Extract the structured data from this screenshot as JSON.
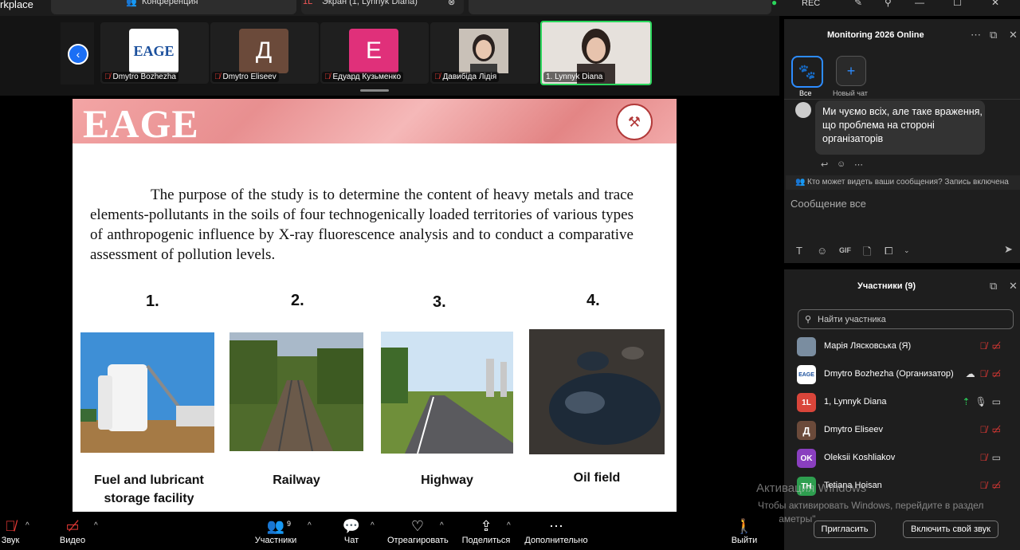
{
  "window": {
    "app_title": "rkplace"
  },
  "tabs": [
    {
      "label": "Конференция"
    },
    {
      "label": "Экран (1, Lynnyk Diana)"
    }
  ],
  "top_right": {
    "rec_label": "REC"
  },
  "thumbnails": [
    {
      "name": "Dmytro Bozhezha",
      "avatar_text": "EAGE",
      "color": "#ffffff"
    },
    {
      "name": "Dmytro Eliseev",
      "avatar_text": "Д",
      "color": "#6b4a3a"
    },
    {
      "name": "Едуард Кузьменко",
      "avatar_text": "Е",
      "color": "#e0307a"
    },
    {
      "name": "Давибіда Лідія",
      "avatar_text": "",
      "color": "#d8d0c8"
    },
    {
      "name": "1. Lynnyk Diana",
      "avatar_text": "",
      "color": "#e8e2dc"
    }
  ],
  "slide": {
    "logo": "EAGE",
    "purpose": "The purpose of the study is to determine the content of heavy metals and trace elements-pollutants in the soils of four technogenically loaded territories of various types of anthropogenic influence by X-ray fluorescence analysis and to conduct a comparative assessment of pollution levels.",
    "items": [
      {
        "num": "1.",
        "caption": "Fuel and lubricant storage facility"
      },
      {
        "num": "2.",
        "caption": "Railway"
      },
      {
        "num": "3.",
        "caption": "Highway"
      },
      {
        "num": "4.",
        "caption": "Oil field"
      }
    ]
  },
  "chat": {
    "title": "Monitoring 2026 Online",
    "tab_all": "Все",
    "tab_new": "Новый чат",
    "message": "Ми чуємо всіх, але таке враження, що проблема на стороні організаторів",
    "visibility_note": "Кто может видеть ваши сообщения? Запись включена",
    "input_placeholder": "Сообщение все",
    "gif_label": "GIF"
  },
  "participants_panel": {
    "title": "Участники (9)",
    "search_placeholder": "Найти участника",
    "list": [
      {
        "name": "Марія Лясковська (Я)",
        "avatar_text": "",
        "color": "#7a8da0"
      },
      {
        "name": "Dmytro Bozhezha (Организатор)",
        "avatar_text": "EAGE",
        "color": "#ffffff"
      },
      {
        "name": "1, Lynnyk Diana",
        "avatar_text": "1L",
        "color": "#d9453a"
      },
      {
        "name": "Dmytro Eliseev",
        "avatar_text": "Д",
        "color": "#6b4a3a"
      },
      {
        "name": "Oleksii Koshliakov",
        "avatar_text": "OK",
        "color": "#8a3fbf"
      },
      {
        "name": "Tetiana Hoisan",
        "avatar_text": "TH",
        "color": "#2e9e4f"
      }
    ],
    "invite_button": "Пригласить",
    "unmute_button": "Включить свой звук"
  },
  "watermark": {
    "line1": "Активация Windows",
    "line2": "Чтобы активировать Windows, перейдите в раздел",
    "line3": "\"Параметры\"."
  },
  "toolbar": {
    "audio": "Звук",
    "video": "Видео",
    "participants": "Участники",
    "participants_count": "9",
    "chat": "Чат",
    "react": "Отреагировать",
    "share": "Поделиться",
    "more": "Дополнительно",
    "leave": "Выйти"
  }
}
